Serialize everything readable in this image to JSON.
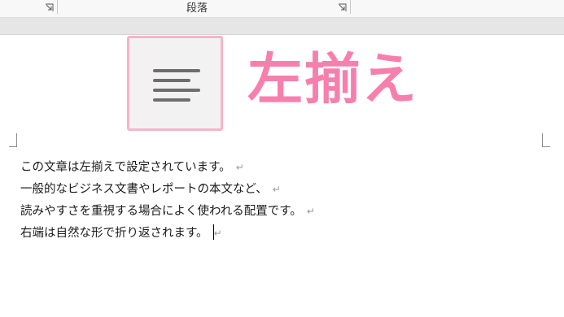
{
  "ribbon": {
    "group_label": "段落"
  },
  "alignment": {
    "button_icon": "align-left-icon",
    "title": "左揃え",
    "title_color": "#f77fae",
    "border_color": "#f9b3c9"
  },
  "document": {
    "paragraph_mark": "↵",
    "paragraphs": [
      "この文章は左揃えで設定されています。",
      "一般的なビジネス文書やレポートの本文など、",
      "読みやすさを重視する場合によく使われる配置です。",
      "右端は自然な形で折り返されます。"
    ]
  }
}
